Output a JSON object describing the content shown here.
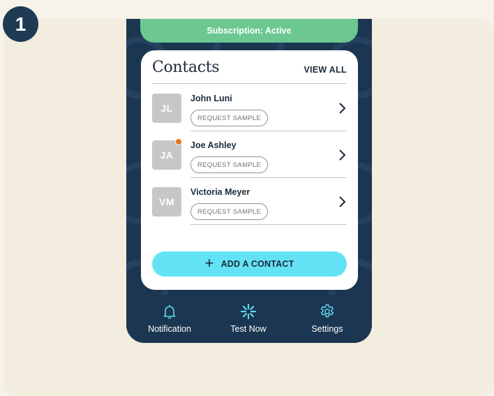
{
  "step_badge": "1",
  "subscription_banner": "Subscription: Active",
  "contacts_card": {
    "title": "Contacts",
    "view_all": "VIEW ALL",
    "contacts": [
      {
        "initials": "JL",
        "name": "John Luni",
        "action": "REQUEST SAMPLE",
        "notification": false
      },
      {
        "initials": "JA",
        "name": "Joe Ashley",
        "action": "REQUEST SAMPLE",
        "notification": true
      },
      {
        "initials": "VM",
        "name": "Victoria Meyer",
        "action": "REQUEST SAMPLE",
        "notification": false
      }
    ],
    "add_contact": "ADD A CONTACT"
  },
  "tabbar": {
    "items": [
      {
        "label": "Notification",
        "icon": "bell-icon"
      },
      {
        "label": "Test Now",
        "icon": "burst-icon"
      },
      {
        "label": "Settings",
        "icon": "gear-icon"
      }
    ]
  },
  "colors": {
    "page_bg": "#f7f3ea",
    "panel_bg": "#f3ede0",
    "navy": "#1b3651",
    "banner_green": "#6cc791",
    "button_cyan": "#64e2f5",
    "icon_cyan": "#5fd9ee",
    "notification_dot": "#e8741a"
  }
}
